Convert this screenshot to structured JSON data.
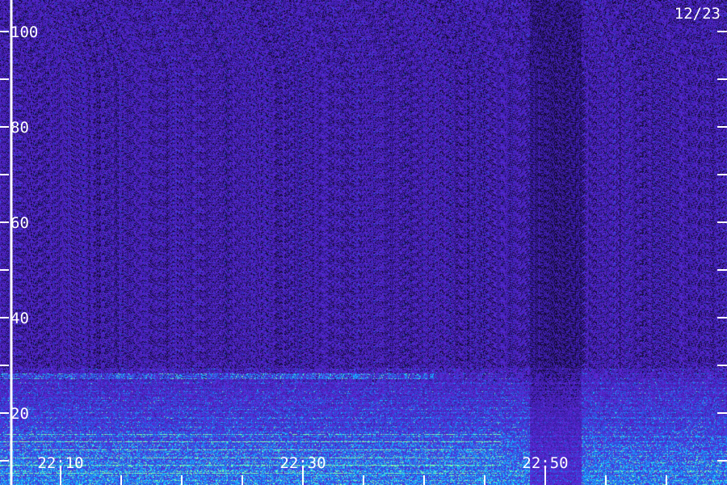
{
  "chart_data": {
    "type": "heatmap",
    "date_label": "12/23",
    "y_ticks": [
      {
        "value": 20,
        "label": "20"
      },
      {
        "value": 40,
        "label": "40"
      },
      {
        "value": 60,
        "label": "60"
      },
      {
        "value": 80,
        "label": "80"
      },
      {
        "value": 100,
        "label": "100"
      }
    ],
    "x_ticks": [
      {
        "value": "22:10",
        "label": "22:10"
      },
      {
        "value": "22:30",
        "label": "22:30"
      },
      {
        "value": "22:50",
        "label": "22:50"
      }
    ],
    "y_range": [
      0,
      100
    ],
    "minor_y_step": 10,
    "x_minor_minutes": 5,
    "x_start_time": "22:05",
    "x_end_time": "23:05",
    "colors": {
      "background": "#2a1670",
      "noise_high": "#5a2bd0",
      "band_low": "#2a55e0",
      "band_mid": "#19b7ff",
      "band_hot": "#7dffb0",
      "axis": "#ffffff"
    }
  }
}
